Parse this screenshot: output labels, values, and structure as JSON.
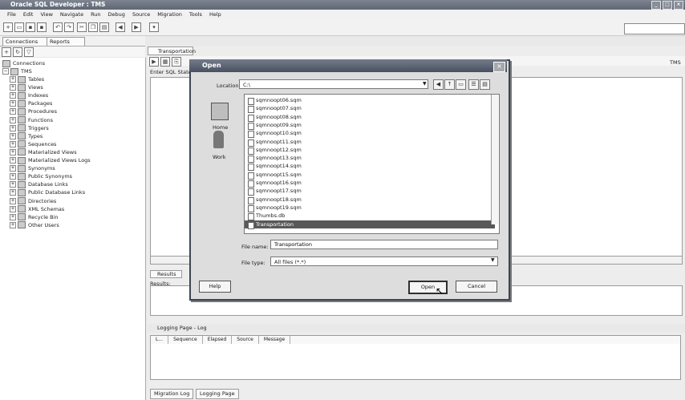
{
  "window": {
    "title": "Oracle SQL Developer : TMS"
  },
  "menu": [
    "File",
    "Edit",
    "View",
    "Navigate",
    "Run",
    "Debug",
    "Source",
    "Migration",
    "Tools",
    "Help"
  ],
  "left_panel": {
    "tabs": [
      "Connections",
      "Reports"
    ],
    "root": "Connections",
    "connection": "TMS",
    "nodes": [
      "Tables",
      "Views",
      "Indexes",
      "Packages",
      "Procedures",
      "Functions",
      "Triggers",
      "Types",
      "Sequences",
      "Materialized Views",
      "Materialized Views Logs",
      "Synonyms",
      "Public Synonyms",
      "Database Links",
      "Public Database Links",
      "Directories",
      "XML Schemas",
      "Recycle Bin",
      "Other Users"
    ]
  },
  "editor": {
    "tab": "Transportation",
    "label": "Enter SQL State",
    "conn_selector": "TMS"
  },
  "results": {
    "tab": "Results",
    "label": "Results:"
  },
  "log": {
    "title": "Logging Page - Log",
    "columns": [
      "L...",
      "Sequence",
      "Elapsed",
      "Source",
      "Message"
    ]
  },
  "bottom_tabs": [
    "Migration Log",
    "Logging Page"
  ],
  "dialog": {
    "title": "Open",
    "location_label": "Location:",
    "location_value": "C:\\",
    "places": [
      "Home",
      "Work"
    ],
    "files": [
      "sqmnoopt06.sqm",
      "sqmnoopt07.sqm",
      "sqmnoopt08.sqm",
      "sqmnoopt09.sqm",
      "sqmnoopt10.sqm",
      "sqmnoopt11.sqm",
      "sqmnoopt12.sqm",
      "sqmnoopt13.sqm",
      "sqmnoopt14.sqm",
      "sqmnoopt15.sqm",
      "sqmnoopt16.sqm",
      "sqmnoopt17.sqm",
      "sqmnoopt18.sqm",
      "sqmnoopt19.sqm",
      "Thumbs.db",
      "Transportation"
    ],
    "selected_file": "Transportation",
    "filename_label": "File name:",
    "filename_value": "Transportation",
    "filetype_label": "File type:",
    "filetype_value": "All files (*.*)",
    "help_button": "Help",
    "open_button": "Open",
    "cancel_button": "Cancel"
  }
}
